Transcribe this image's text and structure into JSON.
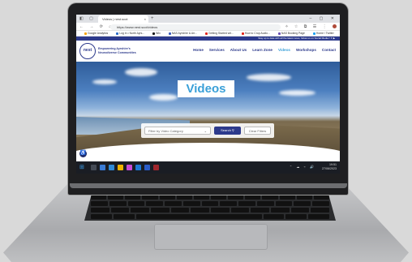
{
  "browser": {
    "tab_title": "Videos | nest.scot",
    "tab_close": "×",
    "new_tab": "+",
    "window_controls": "– ▢ ✕",
    "tab_icons": "◧ ▢",
    "nav": "← → ⟳ ⌂",
    "url": "https://www.nest.scot/videos",
    "right_icons": "✧ ☆ ⧉ ☰ ⋮"
  },
  "bookmarks": [
    {
      "label": "Google Analytics",
      "color": "#f4a100"
    },
    {
      "label": "Log in • North Ayrs...",
      "color": "#2a6ac7"
    },
    {
      "label": "Wix",
      "color": "#111111"
    },
    {
      "label": "NAS Ayrshire & Arr...",
      "color": "#3b5bbd"
    },
    {
      "label": "Getting Started wit...",
      "color": "#e2231a"
    },
    {
      "label": "How to Crop Audio...",
      "color": "#e2231a"
    },
    {
      "label": "NAS Booking Page",
      "color": "#6a4fb3"
    },
    {
      "label": "Home / Twitter",
      "color": "#1da1f2"
    },
    {
      "label": "Facebook",
      "color": "#1877f2"
    }
  ],
  "site": {
    "top_strip": "Stay up to date with all the latest news, follow us on Social Media  f  ✦  ▶",
    "logo_text": "nest",
    "tagline": "Empowering Ayrshire's Neurodiverse Communities",
    "nav": [
      "Home",
      "Services",
      "About Us",
      "Learn Zone",
      "Videos",
      "Workshops",
      "Contact"
    ],
    "active_nav": "Videos",
    "hero_title": "Videos",
    "filter_placeholder": "Filter by Video Category",
    "filter_chevron": "⌄",
    "search_label": "Search  ⚲",
    "clear_label": "Clear Filters",
    "accessibility_icon": "♿"
  },
  "taskbar": {
    "start_icon": "⊞",
    "app_colors": [
      "#444a55",
      "#3a7bd5",
      "#2f89d6",
      "#f0b400",
      "#c94ad7",
      "#1e78d4",
      "#2a5cc9",
      "#a0262c"
    ],
    "sys_icons": "⌃ ☁ ⌁ 🔊",
    "time": "19:51",
    "date": "27/06/2023"
  }
}
